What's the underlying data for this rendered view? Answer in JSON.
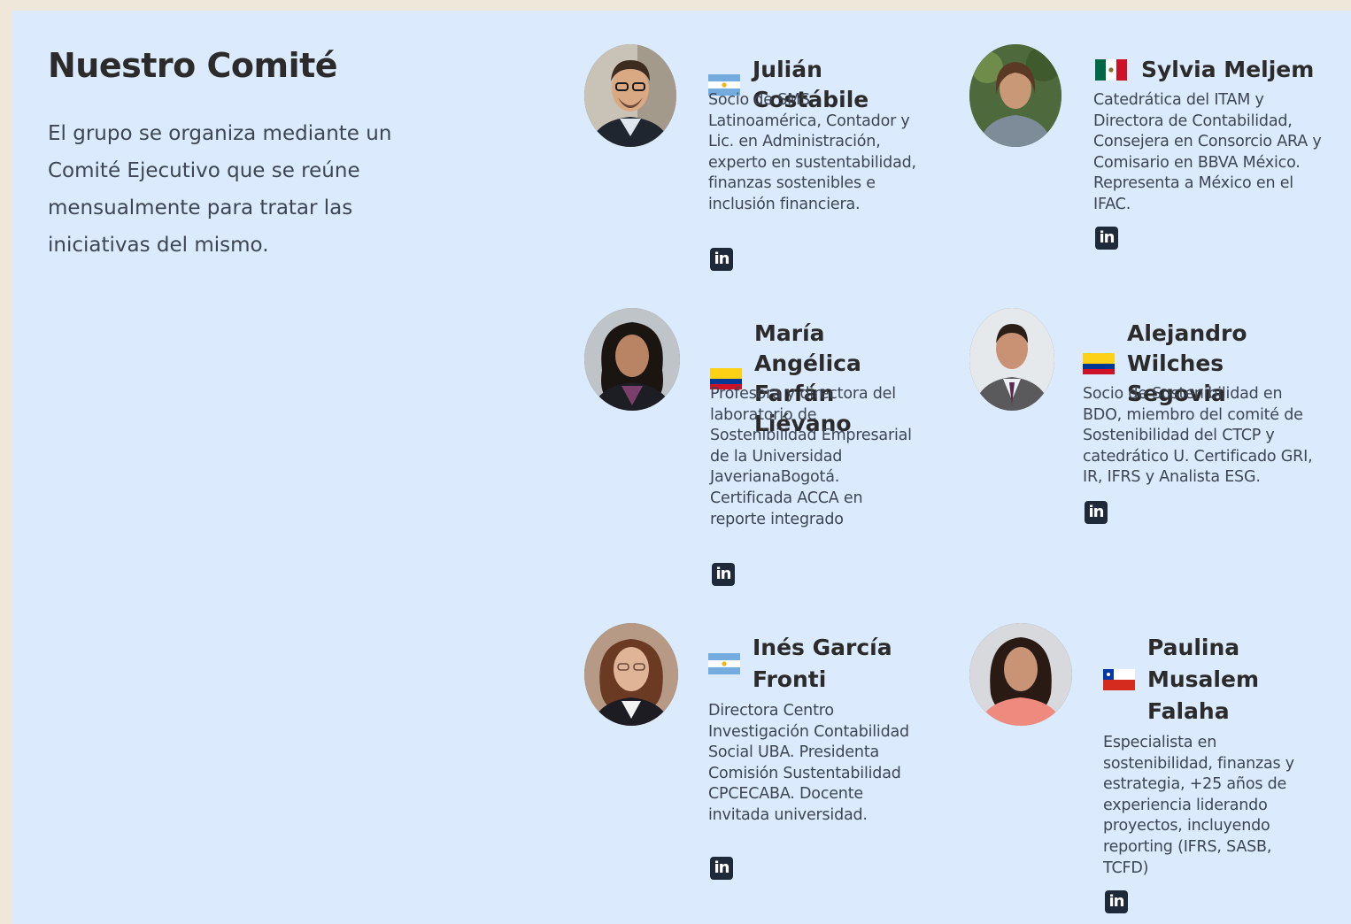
{
  "section": {
    "title": "Nuestro Comité",
    "intro": "El grupo se organiza mediante un Comité Ejecutivo que se reúne mensualmente para tratar las iniciativas del mismo."
  },
  "members": [
    {
      "name": "Julián Costábile",
      "country_flag": "argentina-flag-icon",
      "description": "Socio de SMS Latinoamérica, Contador y Lic. en Administración, experto en sustentabilidad, finanzas sostenibles e inclusión financiera.",
      "linkedin_icon": "linkedin-icon",
      "linkedin_glyph": "in"
    },
    {
      "name": "Sylvia Meljem",
      "country_flag": "mexico-flag-icon",
      "description": "Catedrática del ITAM y Directora de Contabilidad, Consejera en Consorcio ARA y Comisario en BBVA México. Representa a México en el IFAC.",
      "linkedin_icon": "linkedin-icon",
      "linkedin_glyph": "in"
    },
    {
      "name": "María Angélica Farfán Liévano",
      "country_flag": "colombia-flag-icon",
      "description": "Profesora y directora del laboratorio de Sostenibilidad Empresarial de la Universidad JaverianaBogotá. Certificada ACCA en reporte integrado",
      "linkedin_icon": "linkedin-icon",
      "linkedin_glyph": "in"
    },
    {
      "name": "Alejandro Wilches Segovia",
      "country_flag": "colombia-flag-icon",
      "description": "Socio de Sostenibilidad en BDO, miembro del comité de Sostenibilidad del CTCP y catedrático U. Certificado GRI, IR, IFRS y Analista ESG.",
      "linkedin_icon": "linkedin-icon",
      "linkedin_glyph": "in"
    },
    {
      "name": "Inés García Fronti",
      "country_flag": "argentina-flag-icon",
      "description": "Directora Centro Investigación Contabilidad Social UBA. Presidenta Comisión Sustentabilidad CPCECABA. Docente invitada universidad.",
      "linkedin_icon": "linkedin-icon",
      "linkedin_glyph": "in"
    },
    {
      "name": "Paulina Musalem Falaha",
      "country_flag": "chile-flag-icon",
      "description": "Especialista en sostenibilidad, finanzas y estrategia, +25 años de experiencia liderando proyectos, incluyendo reporting (IFRS, SASB, TCFD)",
      "linkedin_icon": "linkedin-icon",
      "linkedin_glyph": "in"
    }
  ],
  "colors": {
    "page_background": "#efe7da",
    "panel_background": "#dbeafc",
    "heading_text": "#2b2b2b",
    "body_text": "#3d4652",
    "linkedin_badge": "#1e2a3a"
  }
}
